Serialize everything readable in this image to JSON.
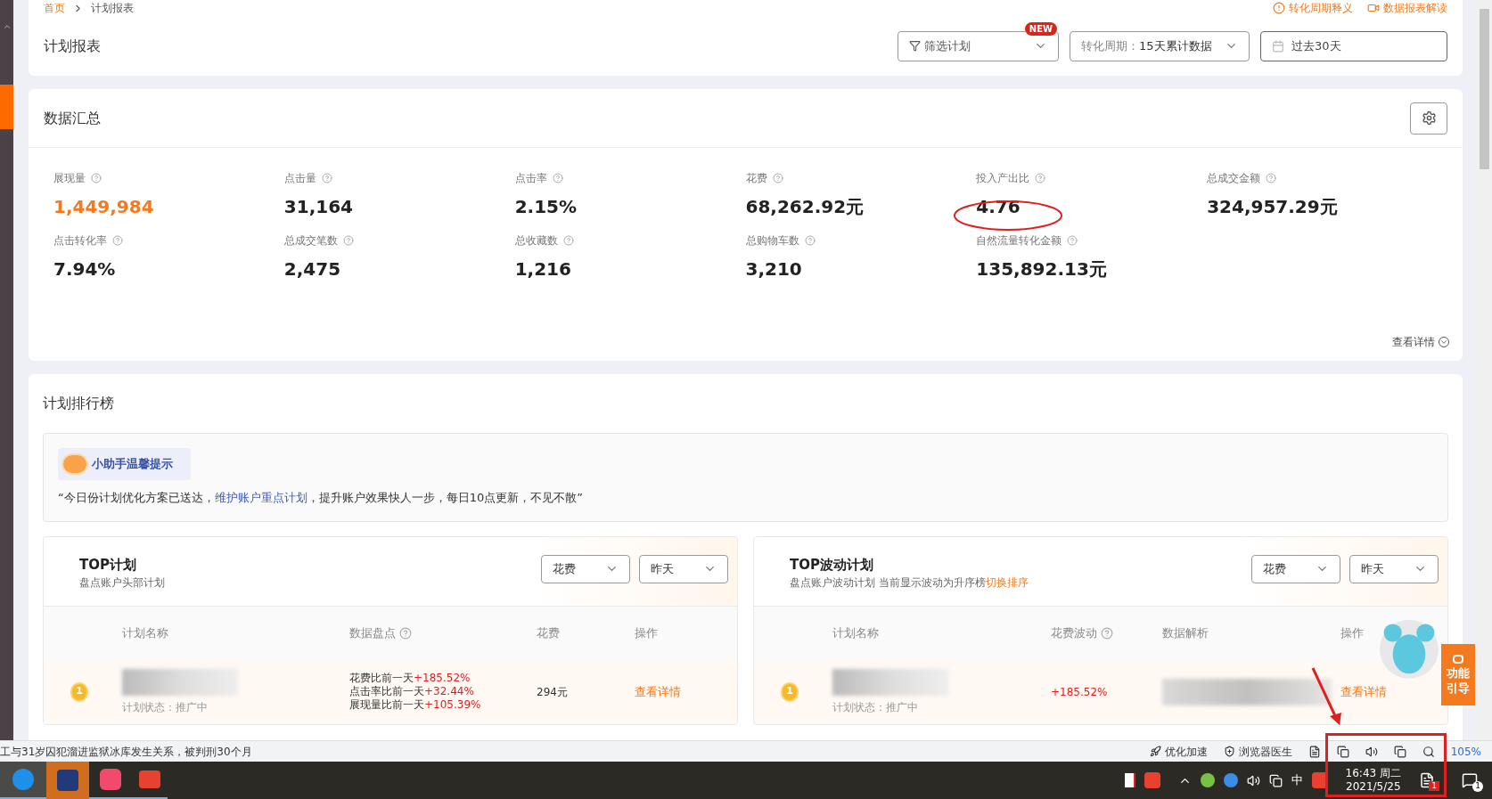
{
  "breadcrumb": [
    {
      "label": "首页",
      "selected": false
    },
    {
      "label": "计划报表",
      "selected": true
    }
  ],
  "header_links": [
    {
      "kind": "info",
      "label": "转化周期释义"
    },
    {
      "kind": "video",
      "label": "数据报表解读"
    }
  ],
  "page_title": "计划报表",
  "filters": [
    {
      "kind": "filter",
      "value": "筛选计划",
      "badge": "NEW"
    },
    {
      "kind": "select",
      "label": "转化周期：",
      "value": "15天累计数据"
    },
    {
      "kind": "date",
      "value": "过去30天"
    }
  ],
  "summary": {
    "title": "数据汇总",
    "more_link": "查看详情",
    "metrics": [
      {
        "label": "展现量",
        "value": "1,449,984",
        "highlighted": true
      },
      {
        "label": "点击量",
        "value": "31,164",
        "highlighted": false
      },
      {
        "label": "点击率",
        "value": "2.15%",
        "highlighted": false
      },
      {
        "label": "花费",
        "value": "68,262.92元",
        "highlighted": false
      },
      {
        "label": "投入产出比",
        "value": "4.76",
        "highlighted": false
      },
      {
        "label": "总成交金额",
        "value": "324,957.29元",
        "highlighted": false
      },
      {
        "label": "点击转化率",
        "value": "7.94%",
        "highlighted": false
      },
      {
        "label": "总成交笔数",
        "value": "2,475",
        "highlighted": false
      },
      {
        "label": "总收藏数",
        "value": "1,216",
        "highlighted": false
      },
      {
        "label": "总购物车数",
        "value": "3,210",
        "highlighted": false
      },
      {
        "label": "自然流量转化金额",
        "value": "135,892.13元",
        "highlighted": false
      }
    ]
  },
  "ranking": {
    "title": "计划排行榜",
    "tip": {
      "title": "小助手温馨提示",
      "text_before": "“今日份计划优化方案已送达，",
      "link": "维护账户重点计划",
      "text_after": "，提升账户效果快人一步，每日10点更新，不见不散”"
    },
    "panels": [
      {
        "title": "TOP计划",
        "subtitle": "盘点账户头部计划",
        "selects": [
          "花费",
          "昨天"
        ],
        "columns": [
          {
            "label": "计划名称",
            "help": false
          },
          {
            "label": "数据盘点",
            "help": true
          },
          {
            "label": "花费",
            "help": false
          },
          {
            "label": "操作",
            "help": false
          }
        ],
        "rows": [
          {
            "rank": "1",
            "status": "计划状态：推广中",
            "cells": [
              {
                "kind": "name"
              },
              {
                "kind": "lines",
                "lines": [
                  {
                    "label": "花费比前一天",
                    "change": "+185.52%"
                  },
                  {
                    "label": "点击率比前一天",
                    "change": "+32.44%"
                  },
                  {
                    "label": "展现量比前一天",
                    "change": "+105.39%"
                  }
                ]
              },
              {
                "kind": "text",
                "value": "294元"
              },
              {
                "kind": "link",
                "value": "查看详情"
              }
            ]
          }
        ]
      },
      {
        "title": "TOP波动计划",
        "subtitle": "盘点账户波动计划 当前显示波动为升序榜",
        "sub_link": "切换排序",
        "selects": [
          "花费",
          "昨天"
        ],
        "columns": [
          {
            "label": "计划名称",
            "help": false
          },
          {
            "label": "花费波动",
            "help": true
          },
          {
            "label": "数据解析",
            "help": false
          },
          {
            "label": "操作",
            "help": false
          }
        ],
        "rows": [
          {
            "rank": "1",
            "status": "计划状态：推广中",
            "cells": [
              {
                "kind": "name"
              },
              {
                "kind": "change",
                "value": "+185.52%"
              },
              {
                "kind": "blurred"
              },
              {
                "kind": "link",
                "value": "查看详情"
              }
            ]
          }
        ]
      }
    ]
  },
  "guide_button": [
    "功能",
    "引导"
  ],
  "status_bar": {
    "news": "工与31岁囚犯溜进监狱冰库发生关系，被判刑30个月",
    "tools": [
      "优化加速",
      "浏览器医生"
    ],
    "zoom": "105%"
  },
  "taskbar": {
    "ime": "中",
    "time": "16:43 周二",
    "date": "2021/5/25",
    "notification_badge": "1",
    "action_center_badge": "1"
  }
}
